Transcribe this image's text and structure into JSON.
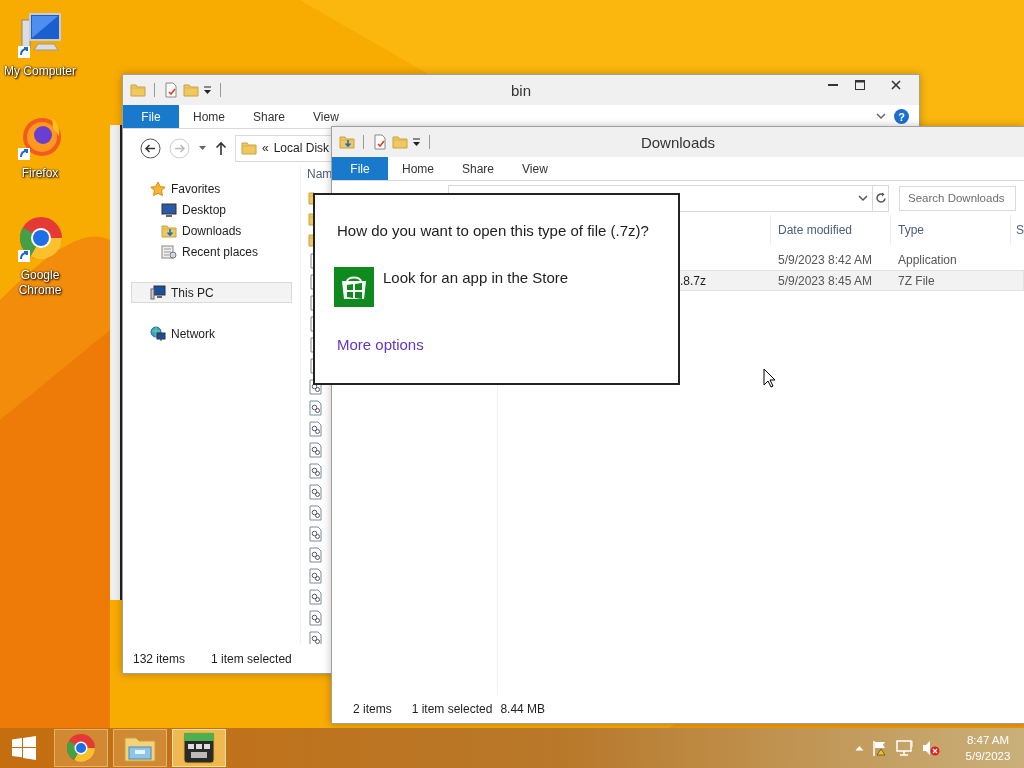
{
  "desktop_icons": [
    {
      "kind": "computer",
      "label": "My Computer"
    },
    {
      "kind": "firefox",
      "label": "Firefox"
    },
    {
      "kind": "chrome",
      "label": "Google Chrome"
    }
  ],
  "bin_window": {
    "title": "bin",
    "ribbon_tabs": [
      {
        "kind": "file",
        "label": "File"
      },
      {
        "kind": "tab",
        "label": "Home"
      },
      {
        "kind": "tab",
        "label": "Share"
      },
      {
        "kind": "tab",
        "label": "View"
      }
    ],
    "help": "?",
    "address": {
      "overflow_mark": "«",
      "path": "Local Disk"
    },
    "nav": [
      {
        "kind": "favorites",
        "label": "Favorites",
        "selected": false,
        "children": [
          {
            "kind": "desktop",
            "label": "Desktop",
            "selected": false
          },
          {
            "kind": "downloads",
            "label": "Downloads",
            "selected": false
          },
          {
            "kind": "recent",
            "label": "Recent places",
            "selected": false
          }
        ]
      },
      {
        "kind": "pc",
        "label": "This PC",
        "selected": true
      },
      {
        "kind": "network",
        "label": "Network",
        "selected": false
      }
    ],
    "columns": [
      "Nam"
    ],
    "files": [
      {
        "kind": "folder"
      },
      {
        "kind": "folder"
      },
      {
        "kind": "folder"
      },
      {
        "kind": "document"
      },
      {
        "kind": "document"
      },
      {
        "kind": "document"
      },
      {
        "kind": "document"
      },
      {
        "kind": "document"
      },
      {
        "kind": "document"
      },
      {
        "kind": "config"
      },
      {
        "kind": "config"
      },
      {
        "kind": "config"
      },
      {
        "kind": "config"
      },
      {
        "kind": "config"
      },
      {
        "kind": "config"
      },
      {
        "kind": "config"
      },
      {
        "kind": "config"
      },
      {
        "kind": "config"
      },
      {
        "kind": "config"
      },
      {
        "kind": "config"
      },
      {
        "kind": "config"
      },
      {
        "kind": "config"
      }
    ],
    "status": {
      "count": "132 items",
      "selection": "1 item selected"
    }
  },
  "downloads_window": {
    "title": "Downloads",
    "ribbon_tabs": [
      {
        "kind": "file",
        "label": "File"
      },
      {
        "kind": "tab",
        "label": "Home"
      },
      {
        "kind": "tab",
        "label": "Share"
      },
      {
        "kind": "tab",
        "label": "View"
      }
    ],
    "search": {
      "placeholder": "Search Downloads"
    },
    "columns": [
      "Date modified",
      "Type",
      "S"
    ],
    "files": [
      {
        "date": "5/9/2023 8:42 AM",
        "type": "Application",
        "selected": false
      },
      {
        "name": ".8.7z",
        "date": "5/9/2023 8:45 AM",
        "type": "7Z File",
        "selected": true
      }
    ],
    "status": {
      "count": "2 items",
      "selection": "1 item selected",
      "size": "8.44 MB"
    }
  },
  "dialog": {
    "question": "How do you want to open this type of file (.7z)?",
    "options": [
      {
        "kind": "store",
        "label": "Look for an app in the Store"
      }
    ],
    "link": "More options"
  },
  "taskbar": {
    "apps": [
      {
        "kind": "start"
      },
      {
        "kind": "chrome",
        "active": false
      },
      {
        "kind": "explorer",
        "active": false
      },
      {
        "kind": "game",
        "active": true
      }
    ],
    "tray": [
      {
        "kind": "caret"
      },
      {
        "kind": "flag"
      },
      {
        "kind": "network"
      },
      {
        "kind": "volume-muted"
      }
    ],
    "time": "8:47 AM",
    "date": "5/9/2023"
  }
}
